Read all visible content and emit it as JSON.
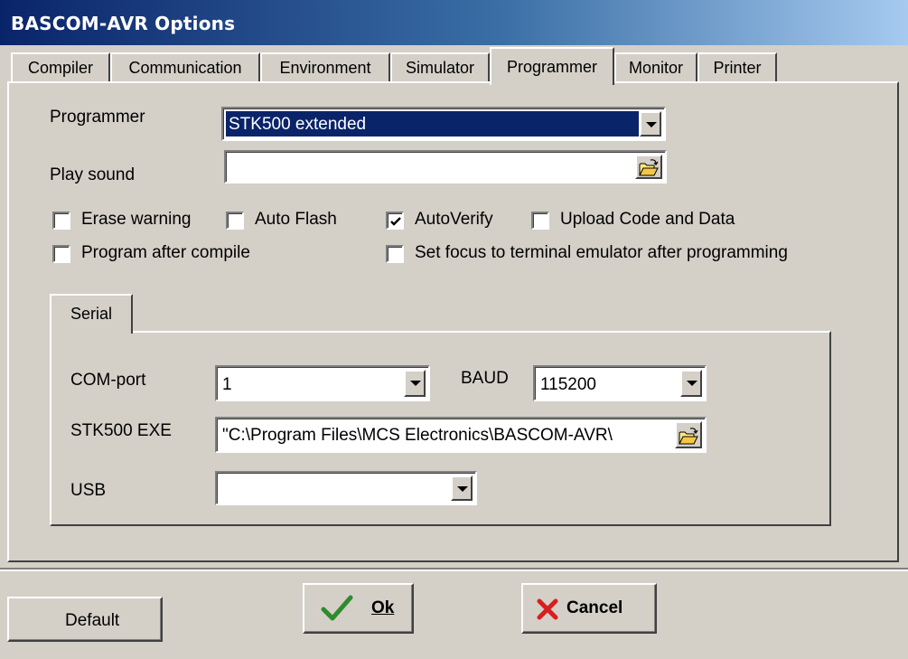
{
  "window": {
    "title": "BASCOM-AVR Options"
  },
  "tabs": [
    {
      "label": "Compiler"
    },
    {
      "label": "Communication"
    },
    {
      "label": "Environment"
    },
    {
      "label": "Simulator"
    },
    {
      "label": "Programmer"
    },
    {
      "label": "Monitor"
    },
    {
      "label": "Printer"
    }
  ],
  "active_tab": "Programmer",
  "programmer": {
    "programmer_label": "Programmer",
    "programmer_value": "STK500 extended",
    "play_sound_label": "Play sound",
    "play_sound_value": ""
  },
  "options": {
    "erase_warning": {
      "label": "Erase warning",
      "checked": false
    },
    "auto_flash": {
      "label": "Auto Flash",
      "checked": false
    },
    "auto_verify": {
      "label": "AutoVerify",
      "checked": true
    },
    "upload_code_data": {
      "label": "Upload Code and Data",
      "checked": false
    },
    "program_after_compile": {
      "label": "Program after compile",
      "checked": false
    },
    "set_focus_terminal": {
      "label": "Set focus to terminal emulator after programming",
      "checked": false
    }
  },
  "serial": {
    "tab_label": "Serial",
    "com_port_label": "COM-port",
    "com_port_value": "1",
    "baud_label": "BAUD",
    "baud_value": "115200",
    "stk500_exe_label": "STK500 EXE",
    "stk500_exe_value": "\"C:\\Program Files\\MCS Electronics\\BASCOM-AVR\\",
    "usb_label": "USB",
    "usb_value": ""
  },
  "buttons": {
    "default": "Default",
    "ok": "Ok",
    "cancel": "Cancel"
  },
  "colors": {
    "titlebar_start": "#0a246a",
    "titlebar_end": "#a6caf0",
    "selection": "#0a246a",
    "face": "#d4d0c8",
    "ok_check": "#2e8b2e",
    "cancel_x": "#d81e1e"
  }
}
